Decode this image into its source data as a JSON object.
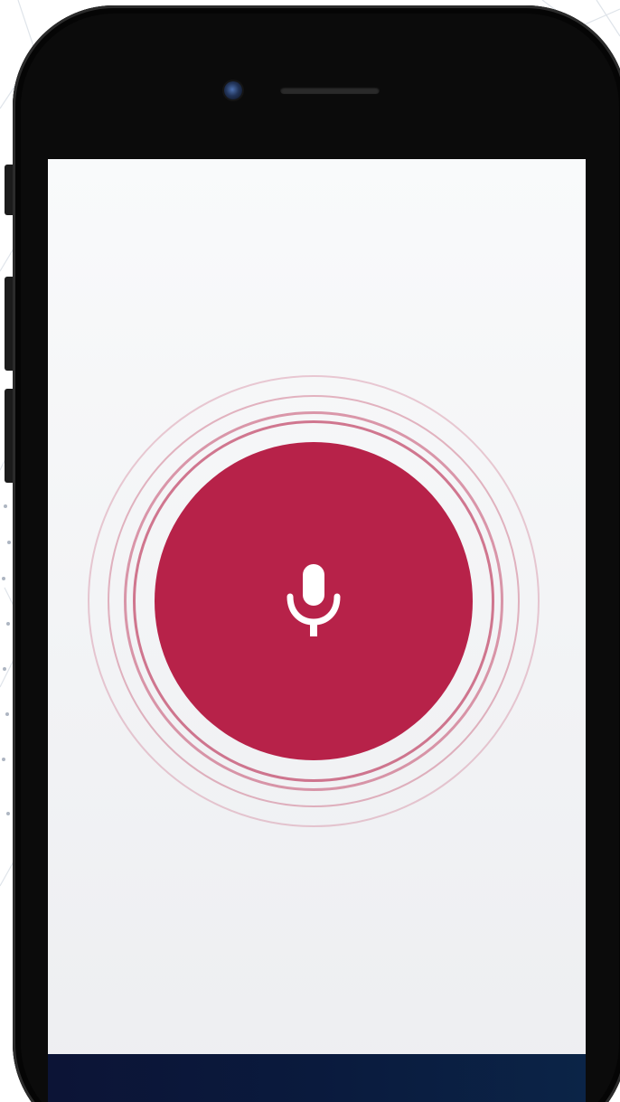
{
  "theme": {
    "accent": "#b72249",
    "ring_color": "#b72249",
    "screen_top": "#f9fafb",
    "screen_bottom": "#edeef1",
    "device_body": "#0b0b0b",
    "bottom_bar": "#0b1a3d"
  },
  "voice_input": {
    "state": "listening",
    "icon": "microphone-icon",
    "ring_count": 4
  }
}
